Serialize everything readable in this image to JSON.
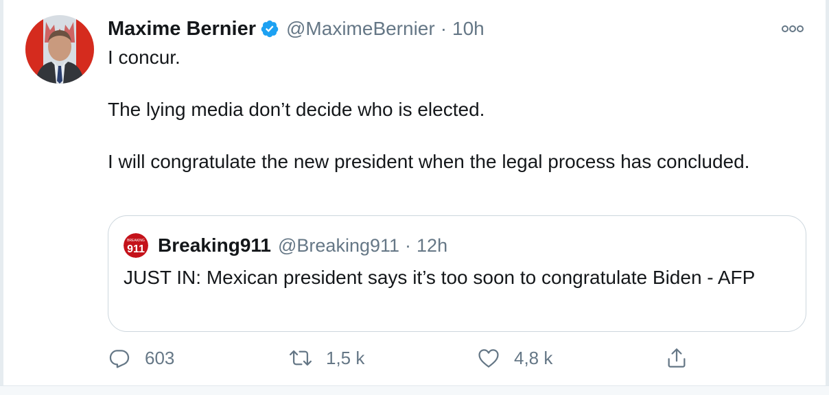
{
  "tweet": {
    "author": {
      "name": "Maxime Bernier",
      "handle": "@MaximeBernier",
      "separator": "·",
      "time": "10h",
      "verified": true,
      "avatar_icon": "portrait-avatar"
    },
    "text_lines": [
      "I concur.",
      "The lying media don’t decide who is elected.",
      "I will congratulate the new president when the legal process has concluded."
    ],
    "quote": {
      "name": "Breaking911",
      "handle": "@Breaking911",
      "separator": "·",
      "time": "12h",
      "avatar_icon": "breaking911-logo",
      "text": "JUST IN: Mexican president says it’s too soon to congratulate Biden - AFP"
    },
    "actions": {
      "reply_count": "603",
      "retweet_count": "1,5 k",
      "like_count": "4,8 k"
    },
    "colors": {
      "verified": "#1da1f2",
      "secondary_text": "#657786",
      "logo_red": "#c4121a"
    }
  }
}
